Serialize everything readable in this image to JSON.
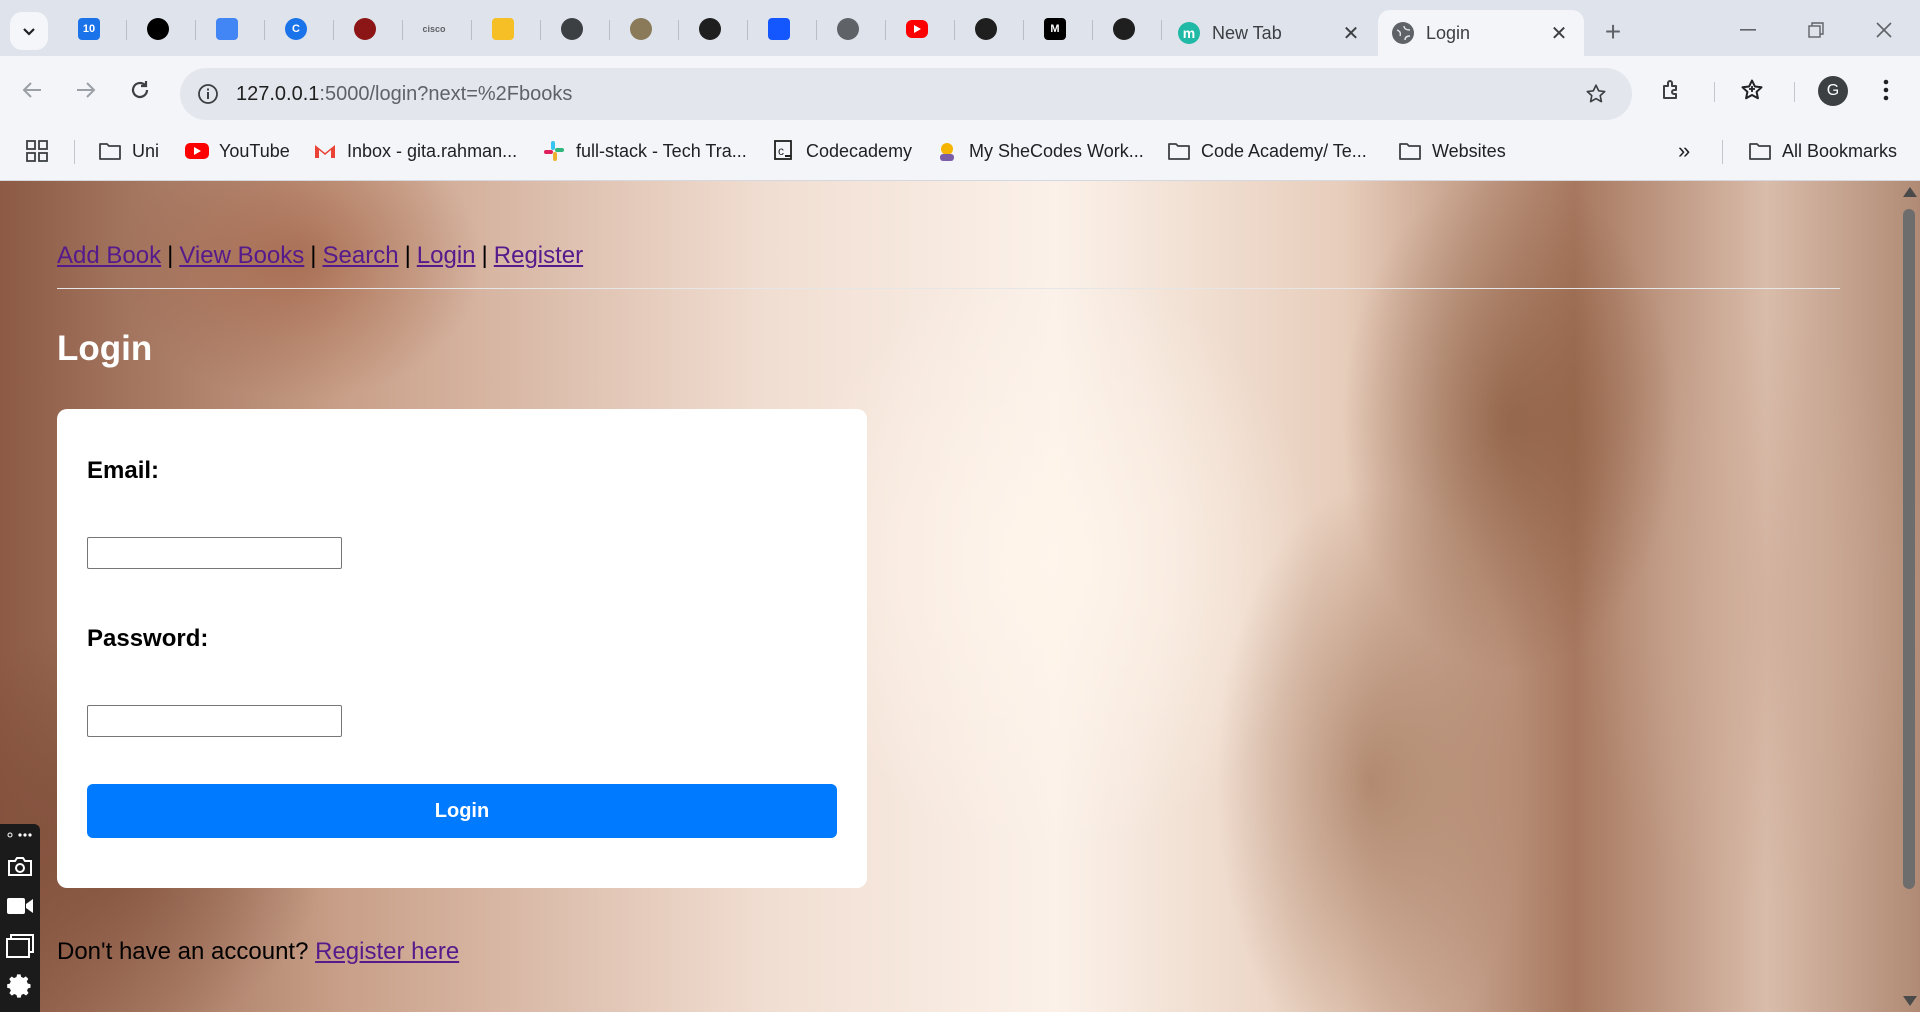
{
  "tabs": {
    "pinned": [
      {
        "name": "calendar-favicon",
        "label": "10",
        "color": "#1a73e8"
      },
      {
        "name": "chatgpt-favicon",
        "label": "",
        "color": "#000000"
      },
      {
        "name": "docs-favicon",
        "label": "",
        "color": "#4285f4"
      },
      {
        "name": "c-favicon",
        "label": "C",
        "color": "#1a73e8"
      },
      {
        "name": "stanford-favicon",
        "label": "",
        "color": "#8c1515"
      },
      {
        "name": "cisco-favicon",
        "label": "cisco",
        "color": "#5f6368"
      },
      {
        "name": "classroom-favicon",
        "label": "",
        "color": "#f6bf26"
      },
      {
        "name": "tower-favicon",
        "label": "",
        "color": "#3c4043"
      },
      {
        "name": "seal-favicon",
        "label": "",
        "color": "#8a7a5a"
      },
      {
        "name": "github-favicon",
        "label": "",
        "color": "#1f1f1f"
      },
      {
        "name": "codecademy-favicon",
        "label": "",
        "color": "#1557ff"
      },
      {
        "name": "globe-favicon",
        "label": "",
        "color": "#5f6368"
      },
      {
        "name": "youtube-favicon",
        "label": "",
        "color": "#ff0000"
      },
      {
        "name": "github-favicon",
        "label": "",
        "color": "#1f1f1f"
      },
      {
        "name": "medium-favicon",
        "label": "M",
        "color": "#000000"
      },
      {
        "name": "github-favicon",
        "label": "",
        "color": "#1f1f1f"
      }
    ],
    "new_tab_title": "New Tab",
    "new_tab_favicon_letter": "m",
    "active_tab_title": "Login"
  },
  "toolbar": {
    "url_host": "127.0.0.1",
    "url_path": ":5000/login?next=%2Fbooks",
    "profile_initial": "G"
  },
  "bookmarks": {
    "items": [
      {
        "label": "Uni",
        "icon": "folder-icon"
      },
      {
        "label": "YouTube",
        "icon": "youtube-icon"
      },
      {
        "label": "Inbox - gita.rahman...",
        "icon": "gmail-icon"
      },
      {
        "label": "full-stack - Tech Tra...",
        "icon": "slack-icon"
      },
      {
        "label": "Codecademy",
        "icon": "codecademy-icon"
      },
      {
        "label": "My SheCodes Work...",
        "icon": "shecodes-icon"
      },
      {
        "label": "Code Academy/ Te...",
        "icon": "folder-icon"
      },
      {
        "label": "Websites",
        "icon": "folder-icon"
      }
    ],
    "more_label": "»",
    "all_bookmarks_label": "All Bookmarks"
  },
  "page": {
    "nav": {
      "add_book": "Add Book",
      "view_books": "View Books",
      "search": "Search",
      "login": "Login",
      "register": "Register",
      "separator": "|"
    },
    "heading": "Login",
    "form": {
      "email_label": "Email:",
      "email_value": "",
      "password_label": "Password:",
      "password_value": "",
      "submit_label": "Login"
    },
    "register_prompt": "Don't have an account?",
    "register_link": "Register here"
  },
  "colors": {
    "accent_button": "#007bff",
    "visited_link": "#551a8b",
    "chrome_frame": "#dfe3eb",
    "chrome_toolbar": "#f3f5f9"
  }
}
